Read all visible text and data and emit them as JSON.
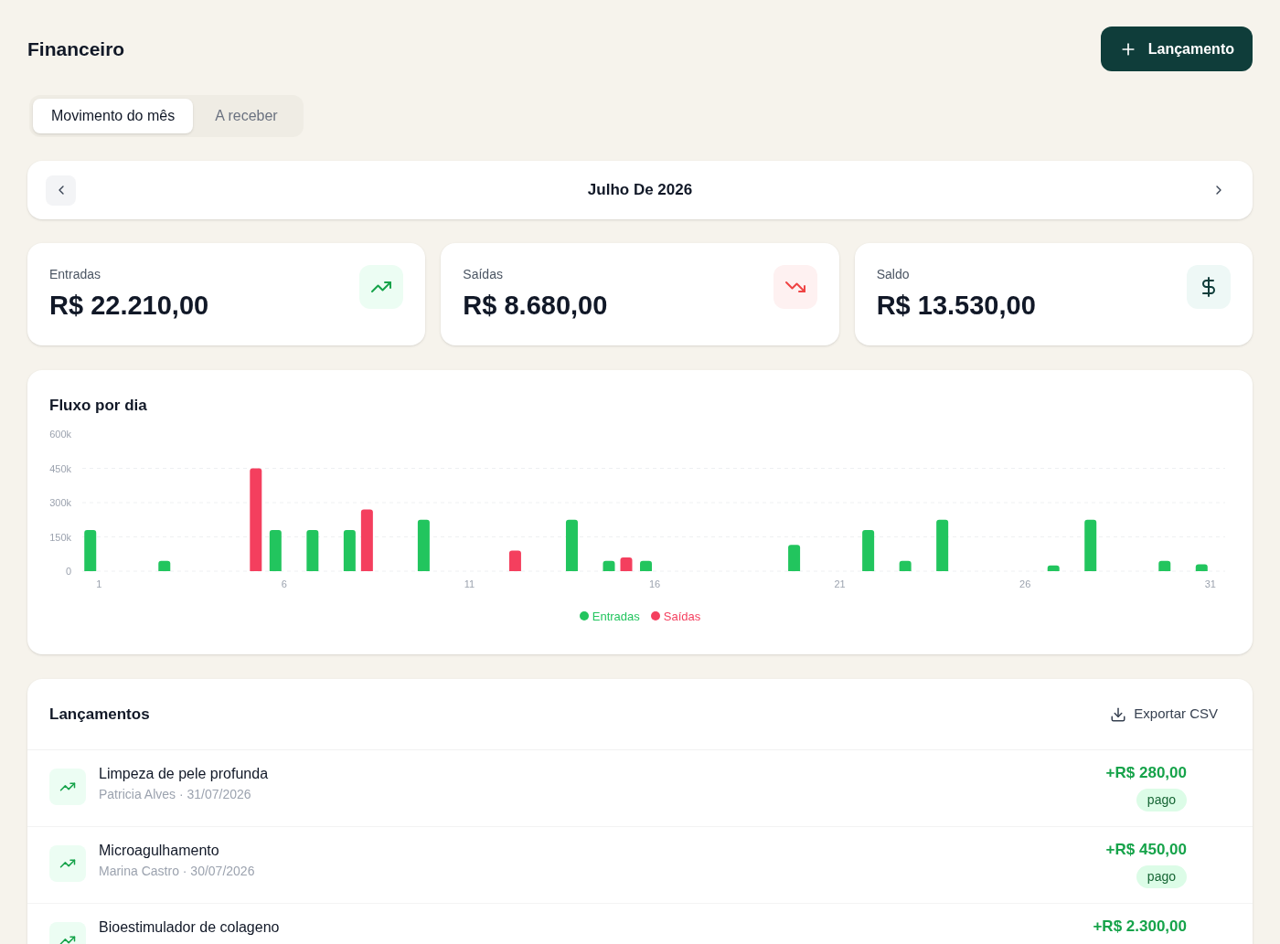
{
  "header": {
    "title": "Financeiro",
    "action_button": "Lançamento"
  },
  "tabs": [
    {
      "label": "Movimento do mês",
      "selected": true
    },
    {
      "label": "A receber",
      "selected": false
    }
  ],
  "month_nav": {
    "label": "Julho De 2026"
  },
  "stats": [
    {
      "label": "Entradas",
      "value": "R$ 22.210,00",
      "kind": "up"
    },
    {
      "label": "Saídas",
      "value": "R$ 8.680,00",
      "kind": "down"
    },
    {
      "label": "Saldo",
      "value": "R$ 13.530,00",
      "kind": "balance"
    }
  ],
  "flow_chart": {
    "title": "Fluxo por dia",
    "chart_data": {
      "type": "bar",
      "x": [
        1,
        2,
        3,
        4,
        5,
        6,
        7,
        8,
        9,
        10,
        11,
        12,
        13,
        14,
        15,
        16,
        17,
        18,
        19,
        20,
        21,
        22,
        23,
        24,
        25,
        26,
        27,
        28,
        29,
        30,
        31
      ],
      "xticks": [
        1,
        6,
        11,
        16,
        21,
        26,
        31
      ],
      "xlim": [
        0.55,
        31.4
      ],
      "grid": true,
      "legend": true,
      "ylim": [
        0,
        600
      ],
      "yticks": [
        0,
        {
          "value": 150,
          "label": "150k"
        },
        {
          "value": 300,
          "label": "300k"
        },
        {
          "value": 450,
          "label": "450k"
        },
        {
          "value": 600,
          "label": "600k"
        }
      ],
      "series": [
        {
          "name": "Entradas",
          "color": "#22c55e",
          "values": [
            180,
            0,
            45,
            0,
            0,
            180,
            180,
            180,
            0,
            225,
            0,
            0,
            0,
            225,
            45,
            45,
            0,
            0,
            0,
            115,
            0,
            180,
            45,
            225,
            0,
            0,
            25,
            225,
            0,
            45,
            30
          ]
        },
        {
          "name": "Saídas",
          "color": "#f43f5e",
          "values": [
            0,
            0,
            0,
            0,
            450,
            0,
            0,
            270,
            0,
            0,
            0,
            90,
            0,
            0,
            60,
            0,
            0,
            0,
            0,
            0,
            0,
            0,
            0,
            0,
            0,
            0,
            0,
            0,
            0,
            0,
            0
          ]
        }
      ]
    }
  },
  "entries": {
    "title": "Lançamentos",
    "export_button": "Exportar CSV",
    "items": [
      {
        "title": "Limpeza de pele profunda",
        "subtitle": "Patricia Alves · 31/07/2026",
        "amount": "+R$ 280,00",
        "status": "pago",
        "kind": "in"
      },
      {
        "title": "Microagulhamento",
        "subtitle": "Marina Castro · 30/07/2026",
        "amount": "+R$ 450,00",
        "status": "pago",
        "kind": "in"
      },
      {
        "title": "Bioestimulador de colageno",
        "amount": "+R$ 2.300,00",
        "kind": "in"
      }
    ]
  }
}
